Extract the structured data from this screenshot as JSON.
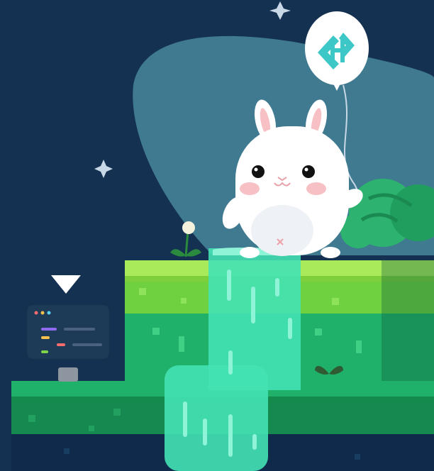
{
  "scene": {
    "colors": {
      "sky": "#143152",
      "glow": "#3f7a91",
      "grass_top": "#a9ea5b",
      "grass_mid": "#6fd13f",
      "grass_green": "#1fb06a",
      "grass_dark": "#15894f",
      "water": "#44e2b4",
      "water_light": "#8ff3d8",
      "bunny": "#ffffff",
      "bunny_pink": "#f7c0c4",
      "balloon": "#ffffff",
      "balloon_logo": "#3ec7c7",
      "bush": "#2db36f",
      "monitor": "#1d3a57",
      "deep": "#0f2a4b"
    },
    "icons": [
      "sparkle-icon",
      "balloon-logo-icon",
      "dandelion-icon",
      "sprout-icon",
      "code-monitor-icon",
      "down-triangle-icon"
    ]
  }
}
